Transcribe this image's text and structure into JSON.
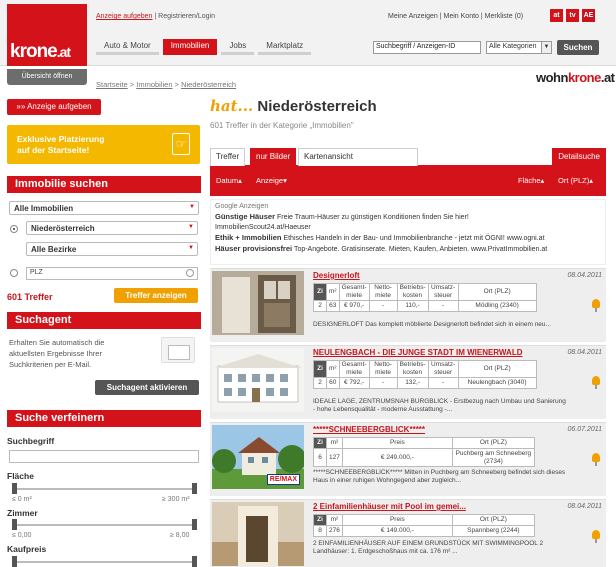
{
  "header": {
    "logo": {
      "word": "krone",
      "suffix": ".at"
    },
    "overview_btn": "Übersicht öffnen",
    "top_links": {
      "post_ad": "Anzeige aufgeben",
      "sep": " | ",
      "register": "Registrieren/Login"
    },
    "account_links": "Meine Anzeigen | Mein Konto | Merkliste (0)",
    "corner_icons": [
      "at",
      "tv",
      "AE"
    ],
    "nav": [
      {
        "label": "Auto & Motor",
        "active": false
      },
      {
        "label": "Immobilien",
        "active": true
      },
      {
        "label": "Jobs",
        "active": false
      },
      {
        "label": "Marktplatz",
        "active": false
      }
    ],
    "search": {
      "value": "Suchbegriff / Anzeigen-ID"
    },
    "category_select": {
      "value": "Alle Kategorien"
    },
    "search_button": "Suchen"
  },
  "breadcrumb": {
    "text_a": "Startseite",
    "sep": " > ",
    "text_b": "Immobilien",
    "text_c": "Niederösterreich"
  },
  "brand": {
    "word": "wohn",
    "brand_red": "krone",
    "suffix": ".at"
  },
  "sidebar": {
    "post_ad_btn": "»» Anzeige aufgeben",
    "promo": {
      "line1": "Exklusive Platzierung",
      "line2": "auf der Startseite!"
    },
    "search_header": "Immobilie suchen",
    "type_select": "Alle Immobilien",
    "region_select": "Niederösterreich",
    "district_select": "Alle Bezirke",
    "plz_value": "PLZ",
    "hit_count": "601 Treffer",
    "show_hits_btn": "Treffer anzeigen",
    "agent_header": "Suchagent",
    "agent_text": "Erhalten Sie automatisch die aktuellsten Ergebnisse Ihrer Suchkriterien per E-Mail.",
    "agent_btn": "Suchagent aktivieren",
    "refine_header": "Suche verfeinern",
    "keyword_label": "Suchbegriff",
    "area_label": "Fläche",
    "area_min": "≤ 0 m²",
    "area_max": "≥ 300 m²",
    "rooms_label": "Zimmer",
    "rooms_min": "≤ 0,00",
    "rooms_max": "≥ 8,00",
    "price_label": "Kaufpreis"
  },
  "main": {
    "title_prefix": "hat...",
    "title": "Niederösterreich",
    "subtitle": "601 Treffer in der Kategorie „Immobilien\"",
    "tabs": [
      {
        "label": "Treffer"
      },
      {
        "label": "nur Bilder"
      },
      {
        "label": "Kartenansicht"
      }
    ],
    "detail_tab": "Detailsuche",
    "sort": {
      "date": "Datum▴",
      "ad": "Anzeige▾",
      "area": "Fläche▴",
      "location": "Ort (PLZ)▴"
    },
    "google_ads": {
      "heading": "Google Anzeigen",
      "ads": [
        {
          "title": "Günstige Häuser",
          "text": "Freie Traum-Häuser zu günstigen Konditionen finden Sie hier!",
          "url": "ImmobilienScout24.at/Haeuser"
        },
        {
          "title": "Ethik + Immobilien",
          "text": "Ethisches Handeln in der Bau- und Immobilienbranche - jetzt mit ÖGNI!",
          "url": "www.ogni.at"
        },
        {
          "title": "Häuser provisionsfrei",
          "text": "Top-Angebote. Gratisinserate. Mieten, Kaufen, Anbieten.",
          "url": "www.PrivatImmobilien.at"
        }
      ]
    },
    "listings": [
      {
        "title": "Designerloft",
        "date": "08.04.2011",
        "headers": [
          "Gesamt-miete",
          "Netto-miete",
          "Betriebs-kosten",
          "Umsatz-steuer",
          "Ort (PLZ)"
        ],
        "rooms": "2",
        "area": "63",
        "values": [
          "€ 970,-",
          "-",
          "110,-",
          "-",
          "Mödling (2340)"
        ],
        "desc": "DESIGNERLOFT Das komplett möblierte Designerloft befindet sich in einem neu..."
      },
      {
        "title": "NEULENGBACH - DIE JUNGE STADT IM WIENERWALD",
        "date": "08.04.2011",
        "headers": [
          "Gesamt-miete",
          "Netto-miete",
          "Betriebs-kosten",
          "Umsatz-steuer",
          "Ort (PLZ)"
        ],
        "rooms": "2",
        "area": "60",
        "values": [
          "€ 792,-",
          "-",
          "132,-",
          "-",
          "Neulengbach (3040)"
        ],
        "desc": "IDEALE LAGE, ZENTRUMSNAH BURGBLICK - Erstbezug nach Umbau und Sanierung - hohe Lebensqualität - moderne Ausstattung -..."
      },
      {
        "title": "*****SCHNEEBERGBLICK*****",
        "date": "06.07.2011",
        "headers": [
          "Preis",
          "Ort (PLZ)"
        ],
        "rooms": "6",
        "area": "127",
        "values": [
          "€ 249.000,-",
          "Puchberg am Schneeberg (2734)"
        ],
        "desc": "*****SCHNEEBERGBLICK***** Mitten in Puchberg am Schneeberg befindet sich dieses Haus in einer ruhigen Wohngegend aber zugleich..."
      },
      {
        "title": "2 Einfamilienhäuser mit Pool im gemei...",
        "date": "08.04.2011",
        "headers": [
          "Preis",
          "Ort (PLZ)"
        ],
        "rooms": "8",
        "area": "276",
        "values": [
          "€ 149.000,-",
          "Spannberg (2244)"
        ],
        "desc": "2 EINFAMILIENHÄUSER AUF EINEM GRUNDSTÜCK MIT SWIMMINGPOOL 2 Landhäuser: 1. Erdgeschoßhaus mit ca. 176 m² ..."
      }
    ],
    "remax_label": "RE/MAX"
  }
}
